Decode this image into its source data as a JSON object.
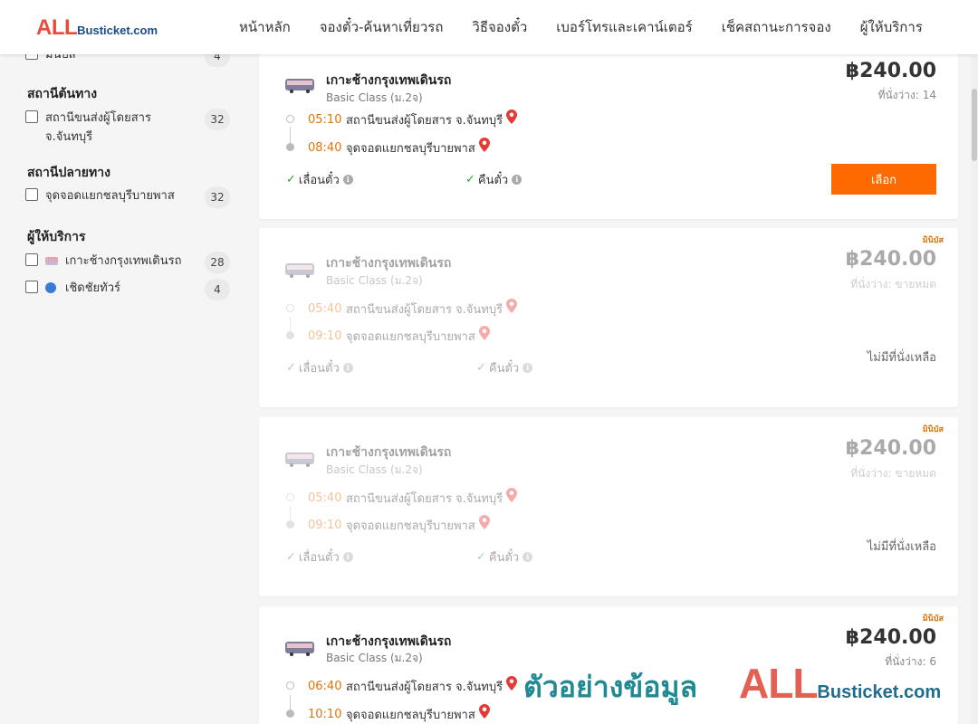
{
  "header": {
    "logo_main": "ALL",
    "logo_rest": "Busticket.com",
    "nav": [
      "หน้าหลัก",
      "จองตั๋ว-ค้นหาเที่ยวรถ",
      "วิธีจองตั๋ว",
      "เบอร์โทรและเคาน์เตอร์",
      "เช็คสถานะการจอง",
      "ผู้ให้บริการ"
    ]
  },
  "sidebar": {
    "top_partial": {
      "label": "มินิบัส",
      "count": "4"
    },
    "origin": {
      "title": "สถานีต้นทาง",
      "items": [
        {
          "label": "สถานีขนส่งผู้โดยสาร จ.จันทบุรี",
          "count": "32"
        }
      ]
    },
    "destination": {
      "title": "สถานีปลายทาง",
      "items": [
        {
          "label": "จุดจอดแยกชลบุรีบายพาส",
          "count": "32"
        }
      ]
    },
    "operators": {
      "title": "ผู้ให้บริการ",
      "items": [
        {
          "label": "เกาะช้างกรุงเทพเดินรถ",
          "count": "28"
        },
        {
          "label": "เชิดชัยทัวร์",
          "count": "4"
        }
      ]
    }
  },
  "trips": [
    {
      "operator": "เกาะช้างกรุงเทพเดินรถ",
      "class": "Basic Class (ม.2จ)",
      "depart_time": "05:10",
      "depart_place": "สถานีขนส่งผู้โดยสาร จ.จันทบุรี",
      "arrive_time": "08:40",
      "arrive_place": "จุดจอดแยกชลบุรีบายพาส",
      "feature1": "เลื่อนตั๋ว",
      "feature2": "คืนตั๋ว",
      "price": "฿240.00",
      "seats": "ที่นั่งว่าง: 14",
      "button": "เลือก",
      "badge": ""
    },
    {
      "operator": "เกาะช้างกรุงเทพเดินรถ",
      "class": "Basic Class (ม.2จ)",
      "depart_time": "05:40",
      "depart_place": "สถานีขนส่งผู้โดยสาร จ.จันทบุรี",
      "arrive_time": "09:10",
      "arrive_place": "จุดจอดแยกชลบุรีบายพาส",
      "feature1": "เลื่อนตั๋ว",
      "feature2": "คืนตั๋ว",
      "price": "฿240.00",
      "seats": "ที่นั่งว่าง: ขายหมด",
      "status": "ไม่มีที่นั่งเหลือ",
      "badge": "มินิบัส"
    },
    {
      "operator": "เกาะช้างกรุงเทพเดินรถ",
      "class": "Basic Class (ม.2จ)",
      "depart_time": "05:40",
      "depart_place": "สถานีขนส่งผู้โดยสาร จ.จันทบุรี",
      "arrive_time": "09:10",
      "arrive_place": "จุดจอดแยกชลบุรีบายพาส",
      "feature1": "เลื่อนตั๋ว",
      "feature2": "คืนตั๋ว",
      "price": "฿240.00",
      "seats": "ที่นั่งว่าง: ขายหมด",
      "status": "ไม่มีที่นั่งเหลือ",
      "badge": "มินิบัส"
    },
    {
      "operator": "เกาะช้างกรุงเทพเดินรถ",
      "class": "Basic Class (ม.2จ)",
      "depart_time": "06:40",
      "depart_place": "สถานีขนส่งผู้โดยสาร จ.จันทบุรี",
      "arrive_time": "10:10",
      "arrive_place": "จุดจอดแยกชลบุรีบายพาส",
      "price": "฿240.00",
      "seats": "ที่นั่งว่าง: 6",
      "badge": "มินิบัส"
    }
  ],
  "watermark": {
    "text": "ตัวอย่างข้อมูล",
    "logo_main": "ALL",
    "logo_rest": "Busticket.com"
  },
  "colors": {
    "accent": "#ff6a00",
    "time": "#e0740a",
    "pin": "#e53935",
    "check": "#2e9e44"
  }
}
